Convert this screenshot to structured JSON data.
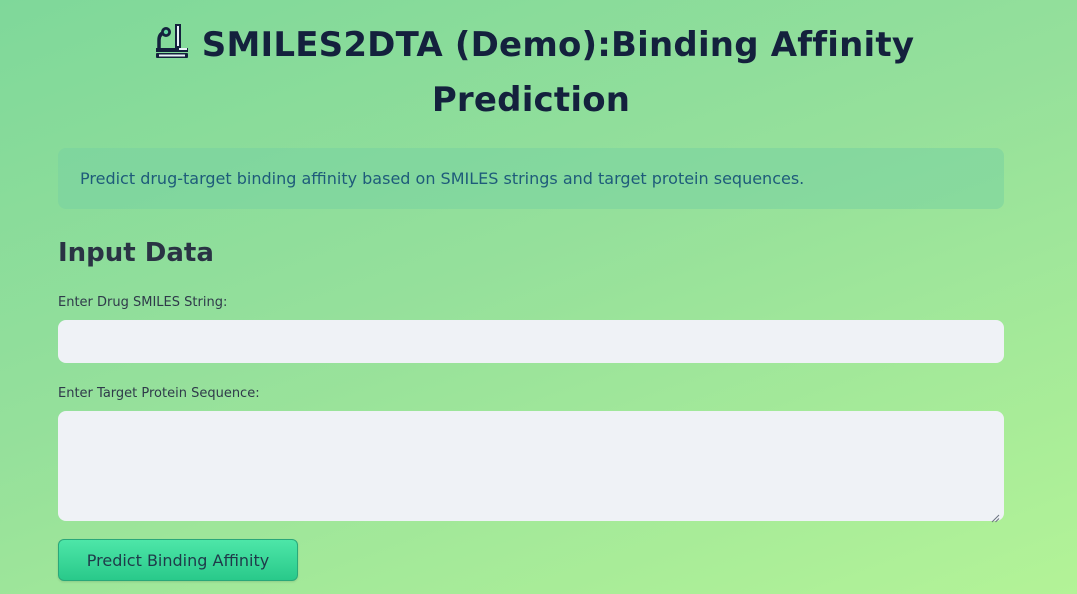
{
  "header": {
    "title": "SMILES2DTA (Demo):Binding Affinity Prediction",
    "icon": "microscope-icon"
  },
  "info": {
    "text": "Predict drug-target binding affinity based on SMILES strings and target protein sequences."
  },
  "input_section": {
    "heading": "Input Data",
    "smiles": {
      "label": "Enter Drug SMILES String:",
      "value": "",
      "placeholder": ""
    },
    "protein": {
      "label": "Enter Target Protein Sequence:",
      "value": "",
      "placeholder": ""
    }
  },
  "actions": {
    "predict_label": "Predict Binding Affinity"
  },
  "colors": {
    "background_start": "#7fd89a",
    "background_end": "#b3f397",
    "title": "#14213d",
    "info_text": "#1e5b7a",
    "input_bg": "#eff2f6",
    "button": "#2fd192"
  }
}
